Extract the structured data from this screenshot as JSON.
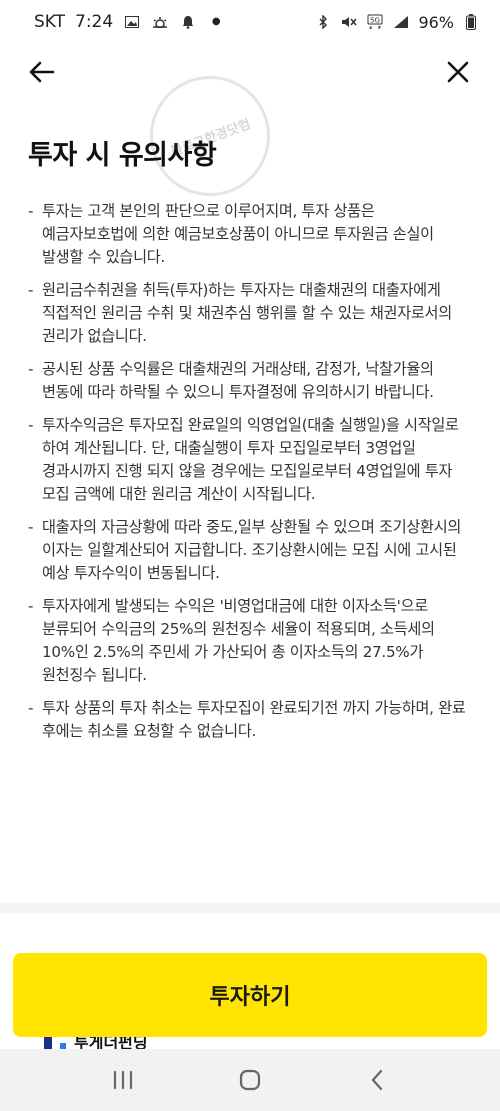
{
  "status_bar": {
    "carrier": "SKT",
    "time": "7:24",
    "battery": "96%",
    "icons_left": [
      "gallery-icon",
      "weather-icon",
      "notification-icon",
      "dot-icon"
    ],
    "icons_right": [
      "bluetooth-icon",
      "mute-icon",
      "5g-icon",
      "signal-icon",
      "battery-icon"
    ]
  },
  "header": {
    "back_icon": "arrow-left-icon",
    "close_icon": "close-icon"
  },
  "page": {
    "title": "투자 시 유의사항",
    "watermark": "블로그한경닷컴"
  },
  "notices": [
    "투자는 고객 본인의 판단으로 이루어지며, 투자 상품은 예금자보호법에 의한 예금보호상품이 아니므로 투자원금 손실이 발생할 수 있습니다.",
    "원리금수취권을 취득(투자)하는 투자자는 대출채권의 대출자에게 직접적인 원리금 수취 및 채권추심 행위를 할 수 있는 채권자로서의 권리가 없습니다.",
    "공시된 상품 수익률은 대출채권의 거래상태, 감정가, 낙찰가율의 변동에 따라 하락될 수 있으니 투자결정에 유의하시기 바랍니다.",
    "투자수익금은 투자모집 완료일의 익영업일(대출 실행일)을 시작일로 하여 계산됩니다. 단, 대출실행이 투자 모집일로부터 3영업일 경과시까지 진행 되지 않을 경우에는 모집일로부터 4영업일에 투자 모집 금액에 대한 원리금 계산이 시작됩니다.",
    "대출자의 자금상황에 따라 중도,일부 상환될 수 있으며 조기상환시의 이자는 일할계산되어 지급합니다. 조기상환시에는 모집 시에 고시된 예상 투자수익이 변동됩니다.",
    "투자자에게 발생되는 수익은 '비영업대금에 대한 이자소득'으로 분류되어 수익금의 25%의 원천징수 세율이 적용되며, 소득세의 10%인 2.5%의 주민세 가 가산되어 총 이자소득의 27.5%가 원천징수 됩니다.",
    "투자 상품의 투자 취소는 투자모집이 완료되기전 까지 가능하며, 완료 후에는 취소를 요청할 수 없습니다."
  ],
  "actions": {
    "invest_label": "투자하기"
  },
  "footer_peek": {
    "text": "투게더펀딩"
  },
  "nav_bar": {
    "icons": [
      "recent-apps-icon",
      "home-icon",
      "back-nav-icon"
    ]
  },
  "colors": {
    "accent": "#ffe500",
    "nav_background": "#f2f2f2"
  }
}
